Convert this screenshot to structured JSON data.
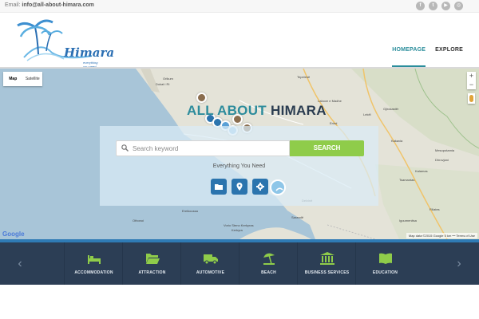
{
  "topbar": {
    "email_label": "Email:",
    "email_value": "info@all-about-himara.com",
    "socials": [
      {
        "icon": "facebook-icon",
        "glyph": "f"
      },
      {
        "icon": "twitter-icon",
        "glyph": "t"
      },
      {
        "icon": "youtube-icon",
        "glyph": "▶"
      },
      {
        "icon": "instagram-icon",
        "glyph": "◎"
      }
    ]
  },
  "header": {
    "logo_text": "Himara",
    "logo_tagline": "everything you need",
    "nav": [
      {
        "label": "HOMEPAGE",
        "active": true
      },
      {
        "label": "EXPLORE",
        "active": false
      }
    ]
  },
  "map": {
    "type_options": [
      "Map",
      "Satellite"
    ],
    "selected_type": "Map",
    "zoom_in": "+",
    "zoom_out": "−",
    "google_logo": "Google",
    "attribution": "Map data ©2015 Google   5 km ⎯⎯   Terms of Use",
    "places": [
      "Tepelenë",
      "Dukat i Ri",
      "Orikum",
      "Labove e Madhe",
      "Gjirokastër",
      "Lekël",
      "Erind",
      "Delvinë",
      "Sarandë",
      "Othonoi",
      "Ereikoussa",
      "Kakavia",
      "Mesopotamia",
      "Dhrovjani",
      "Kalamas",
      "Tsamantas",
      "Filiates",
      "Igoumenitsa",
      "Kerkyra",
      "Vorio Steno Kerkyras"
    ],
    "headline_part1": "ALL ABOUT",
    "headline_part2": "HIMARA"
  },
  "search": {
    "placeholder": "Search keyword",
    "button_label": "SEARCH",
    "subtitle": "Everything You Need",
    "quick_icons": [
      "folder-icon",
      "map-pin-icon",
      "gear-icon",
      "globe-icon"
    ]
  },
  "categories": {
    "items": [
      {
        "label": "ACCOMMODATION",
        "icon": "bed-icon"
      },
      {
        "label": "ATTRACTION",
        "icon": "folder-open-icon"
      },
      {
        "label": "AUTOMOTIVE",
        "icon": "truck-icon"
      },
      {
        "label": "BEACH",
        "icon": "umbrella-icon"
      },
      {
        "label": "BUSINESS SERVICES",
        "icon": "bank-icon"
      },
      {
        "label": "EDUCATION",
        "icon": "book-icon"
      }
    ],
    "prev_glyph": "‹",
    "next_glyph": "›"
  },
  "colors": {
    "accent_teal": "#2a8d9b",
    "category_icon_green": "#8fcc4a",
    "search_button": "#8fcc4a",
    "category_bar_bg": "#2c3e55"
  }
}
